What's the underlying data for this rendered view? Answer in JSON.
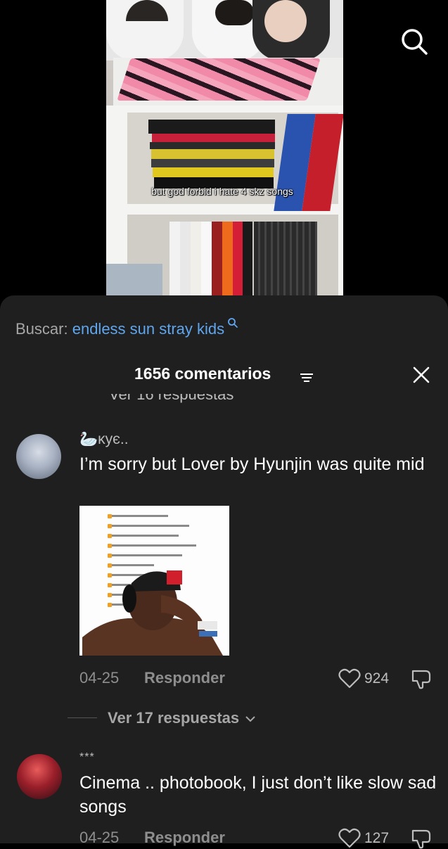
{
  "video": {
    "caption": "but god forbid i hate 4 skz songs"
  },
  "search_bar": {
    "label": "Buscar:",
    "query": "endless sun stray kids"
  },
  "comments_header": {
    "count_label": "1656 comentarios"
  },
  "partial_line": "Ver 16 respuestas",
  "comments": [
    {
      "username": "🦢κує..",
      "text": "I’m sorry but Lover by Hyunjin was quite mid",
      "date": "04-25",
      "reply_label": "Responder",
      "likes": "924"
    },
    {
      "username": "***",
      "text": "Cinema .. photobook, I just don’t like slow sad songs",
      "date": "04-25",
      "reply_label": "Responder",
      "likes": "127"
    }
  ],
  "view_replies": "Ver 17 respuestas",
  "colors": {
    "sheet_bg": "#1f1f1f",
    "search_query": "#5ea6f0",
    "muted_text": "#8e8e8e"
  }
}
